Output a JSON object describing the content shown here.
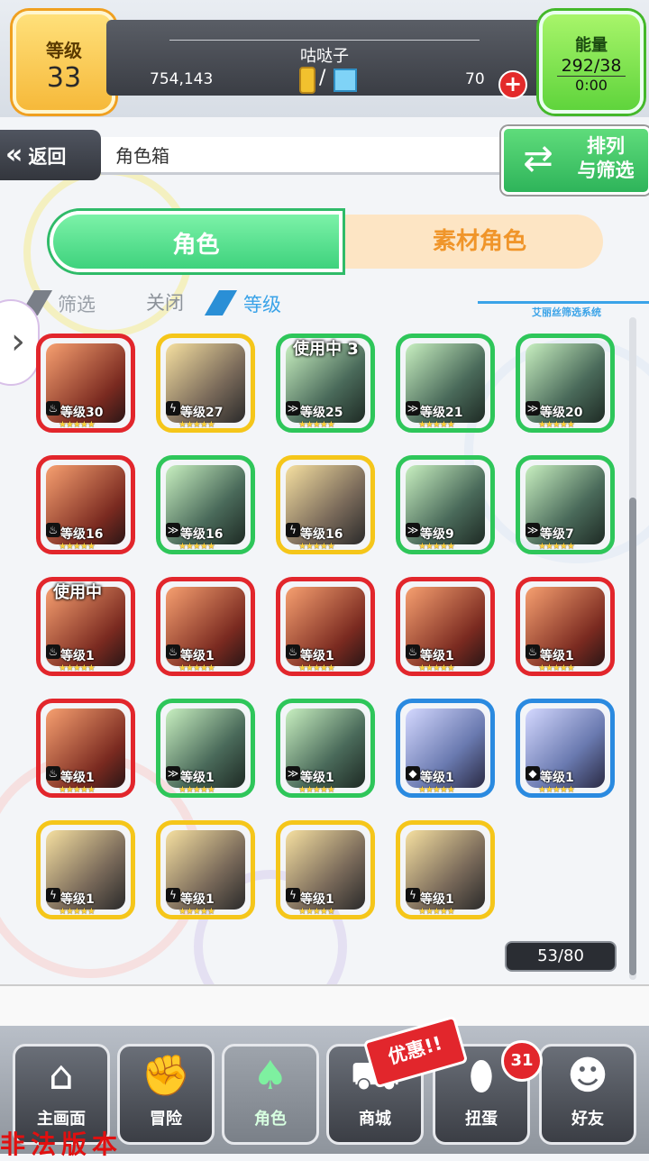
{
  "header": {
    "level_label": "等级",
    "level_value": "33",
    "player_name": "咕哒子",
    "coins": "754,143",
    "gems": "70",
    "energy_label": "能量",
    "energy_value": "292/38",
    "energy_timer": "0:00"
  },
  "nav": {
    "back_label": "返回",
    "screen_title": "角色箱",
    "sort_filter_label_line1": "排列",
    "sort_filter_label_line2": "与筛选"
  },
  "tabs": [
    {
      "label": "角色",
      "active": true
    },
    {
      "label": "素材角色",
      "active": false
    }
  ],
  "filter": {
    "filter_label": "筛选",
    "filter_state": "关闭",
    "sort_label": "等级",
    "system_label": "艾丽丝筛选系统"
  },
  "characters": [
    {
      "level": "等级30",
      "frame": "red",
      "in_use": ""
    },
    {
      "level": "等级27",
      "frame": "yellow",
      "in_use": ""
    },
    {
      "level": "等级25",
      "frame": "green",
      "in_use": "使用中 3"
    },
    {
      "level": "等级21",
      "frame": "green",
      "in_use": ""
    },
    {
      "level": "等级20",
      "frame": "green",
      "in_use": ""
    },
    {
      "level": "等级16",
      "frame": "red",
      "in_use": ""
    },
    {
      "level": "等级16",
      "frame": "green",
      "in_use": ""
    },
    {
      "level": "等级16",
      "frame": "yellow",
      "in_use": ""
    },
    {
      "level": "等级9",
      "frame": "green",
      "in_use": ""
    },
    {
      "level": "等级7",
      "frame": "green",
      "in_use": ""
    },
    {
      "level": "等级1",
      "frame": "red",
      "in_use": "使用中"
    },
    {
      "level": "等级1",
      "frame": "red",
      "in_use": ""
    },
    {
      "level": "等级1",
      "frame": "red",
      "in_use": ""
    },
    {
      "level": "等级1",
      "frame": "red",
      "in_use": ""
    },
    {
      "level": "等级1",
      "frame": "red",
      "in_use": ""
    },
    {
      "level": "等级1",
      "frame": "red",
      "in_use": ""
    },
    {
      "level": "等级1",
      "frame": "green",
      "in_use": ""
    },
    {
      "level": "等级1",
      "frame": "green",
      "in_use": ""
    },
    {
      "level": "等级1",
      "frame": "blue",
      "in_use": ""
    },
    {
      "level": "等级1",
      "frame": "blue",
      "in_use": ""
    },
    {
      "level": "等级1",
      "frame": "yellow",
      "in_use": ""
    },
    {
      "level": "等级1",
      "frame": "yellow",
      "in_use": ""
    },
    {
      "level": "等级1",
      "frame": "yellow",
      "in_use": ""
    },
    {
      "level": "等级1",
      "frame": "yellow",
      "in_use": ""
    }
  ],
  "box_count": "53/80",
  "bottom_nav": [
    {
      "label": "主画面",
      "icon": "home-icon"
    },
    {
      "label": "冒险",
      "icon": "handshake-icon"
    },
    {
      "label": "角色",
      "icon": "rabbit-icon"
    },
    {
      "label": "商城",
      "icon": "cart-icon"
    },
    {
      "label": "扭蛋",
      "icon": "egg-icon"
    },
    {
      "label": "好友",
      "icon": "friends-icon"
    }
  ],
  "promo_label": "优惠!!",
  "gacha_badge": "31",
  "watermark": "非法版本"
}
